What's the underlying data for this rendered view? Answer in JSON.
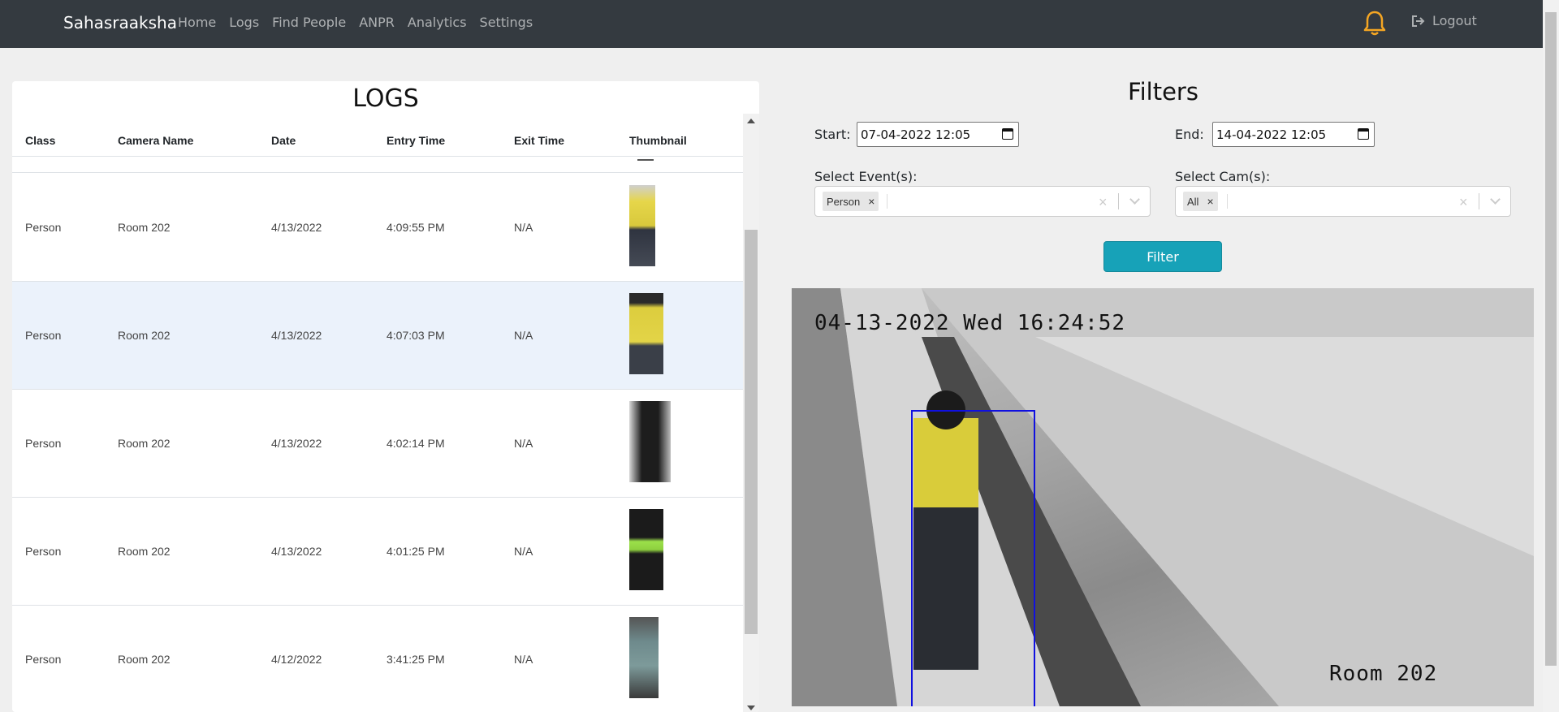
{
  "navbar": {
    "brand": "Sahasraaksha",
    "links": [
      "Home",
      "Logs",
      "Find People",
      "ANPR",
      "Analytics",
      "Settings"
    ],
    "logout_label": "Logout",
    "bell_color": "#f5a623"
  },
  "logs": {
    "title": "LOGS",
    "columns": [
      "Class",
      "Camera Name",
      "Date",
      "Entry Time",
      "Exit Time",
      "Thumbnail"
    ],
    "rows": [
      {
        "class": "Person",
        "camera": "Room 202",
        "date": "4/13/2022",
        "entry": "4:09:55 PM",
        "exit": "N/A"
      },
      {
        "class": "Person",
        "camera": "Room 202",
        "date": "4/13/2022",
        "entry": "4:07:03 PM",
        "exit": "N/A"
      },
      {
        "class": "Person",
        "camera": "Room 202",
        "date": "4/13/2022",
        "entry": "4:02:14 PM",
        "exit": "N/A"
      },
      {
        "class": "Person",
        "camera": "Room 202",
        "date": "4/13/2022",
        "entry": "4:01:25 PM",
        "exit": "N/A"
      },
      {
        "class": "Person",
        "camera": "Room 202",
        "date": "4/12/2022",
        "entry": "3:41:25 PM",
        "exit": "N/A"
      }
    ],
    "highlight_color": "#ebf2fb"
  },
  "filters": {
    "title": "Filters",
    "start_label": "Start:",
    "start_value": "07-04-2022 12:05",
    "end_label": "End:",
    "end_value": "14-04-2022 12:05",
    "events_label": "Select Event(s):",
    "events_selected": "Person",
    "cams_label": "Select Cam(s):",
    "cams_selected": "All",
    "filter_button": "Filter",
    "button_color": "#17a2b8"
  },
  "camera_view": {
    "timestamp": "04-13-2022 Wed 16:24:52",
    "camera_label": "Room  202",
    "box_color": "#1010e0"
  }
}
